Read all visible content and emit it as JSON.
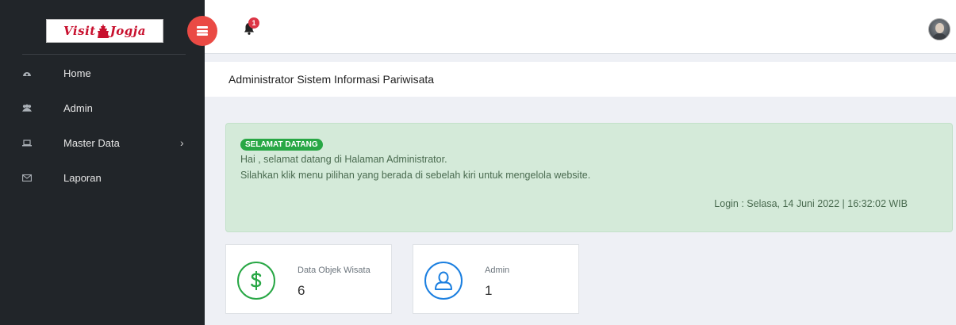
{
  "brand": {
    "logo_text": "Visit Jogja",
    "logo_word1": "Visit",
    "logo_word2": "Jogja"
  },
  "sidebar": {
    "items": [
      {
        "label": "Home",
        "icon": "dashboard-icon",
        "has_submenu": false
      },
      {
        "label": "Admin",
        "icon": "users-icon",
        "has_submenu": false
      },
      {
        "label": "Master Data",
        "icon": "laptop-icon",
        "has_submenu": true
      },
      {
        "label": "Laporan",
        "icon": "envelope-icon",
        "has_submenu": false
      }
    ]
  },
  "topbar": {
    "notification_count": "1"
  },
  "page": {
    "title": "Administrator Sistem Informasi Pariwisata"
  },
  "welcome": {
    "badge": "SELAMAT DATANG",
    "line1": "Hai , selamat datang di Halaman Administrator.",
    "line2": "Silahkan klik menu pilihan yang berada di sebelah kiri untuk mengelola website.",
    "login": "Login : Selasa, 14 Juni 2022 | 16:32:02 WIB"
  },
  "stats": [
    {
      "label": "Data Objek Wisata",
      "value": "6",
      "icon": "dollar-icon",
      "color": "#28a745"
    },
    {
      "label": "Admin",
      "value": "1",
      "icon": "user-icon",
      "color": "#1b7fe0"
    }
  ],
  "colors": {
    "sidebar_bg": "#212529",
    "toggle": "#ea4a44",
    "alert_bg": "#d4ead9",
    "badge_green": "#28a745",
    "brand_red": "#c8102e"
  }
}
